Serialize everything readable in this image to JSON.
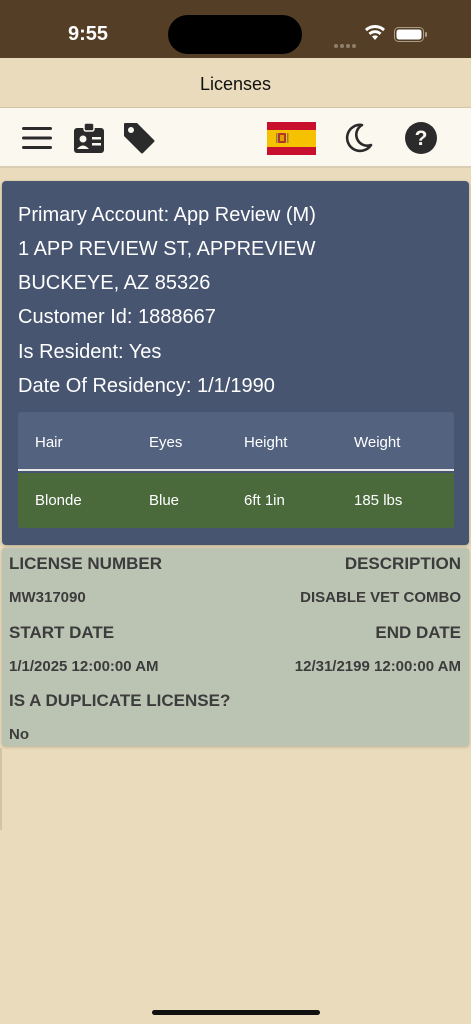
{
  "status": {
    "time": "9:55"
  },
  "nav": {
    "title": "Licenses"
  },
  "toolbar": {
    "icons": [
      "menu-icon",
      "id-badge-icon",
      "tag-icon",
      "spain-flag-icon",
      "moon-icon",
      "help-icon"
    ]
  },
  "account": {
    "primary": "Primary Account: App Review (M)",
    "address1": "1 APP REVIEW ST, APPREVIEW",
    "address2": "BUCKEYE, AZ 85326",
    "customer_id": "Customer Id: 1888667",
    "is_resident": "Is Resident: Yes",
    "residency_date": "Date Of Residency: 1/1/1990",
    "attributes": {
      "headers": [
        "Hair",
        "Eyes",
        "Height",
        "Weight"
      ],
      "values": [
        "Blonde",
        "Blue",
        "6ft 1in",
        "185 lbs"
      ]
    }
  },
  "license": {
    "number_label": "LICENSE NUMBER",
    "description_label": "DESCRIPTION",
    "number": "MW317090",
    "description": "DISABLE VET COMBO",
    "start_label": "START DATE",
    "end_label": "END DATE",
    "start": "1/1/2025 12:00:00 AM",
    "end": "12/31/2199 12:00:00 AM",
    "duplicate_label": "IS A DUPLICATE LICENSE?",
    "duplicate": "No"
  },
  "colors": {
    "status_bar": "#543f26",
    "background": "#e9dbbb",
    "toolbar": "#fbf8f0",
    "account_panel": "#475570",
    "table_header": "#53627f",
    "table_row": "#4a6a3c",
    "license_card": "#bbc3b2"
  }
}
